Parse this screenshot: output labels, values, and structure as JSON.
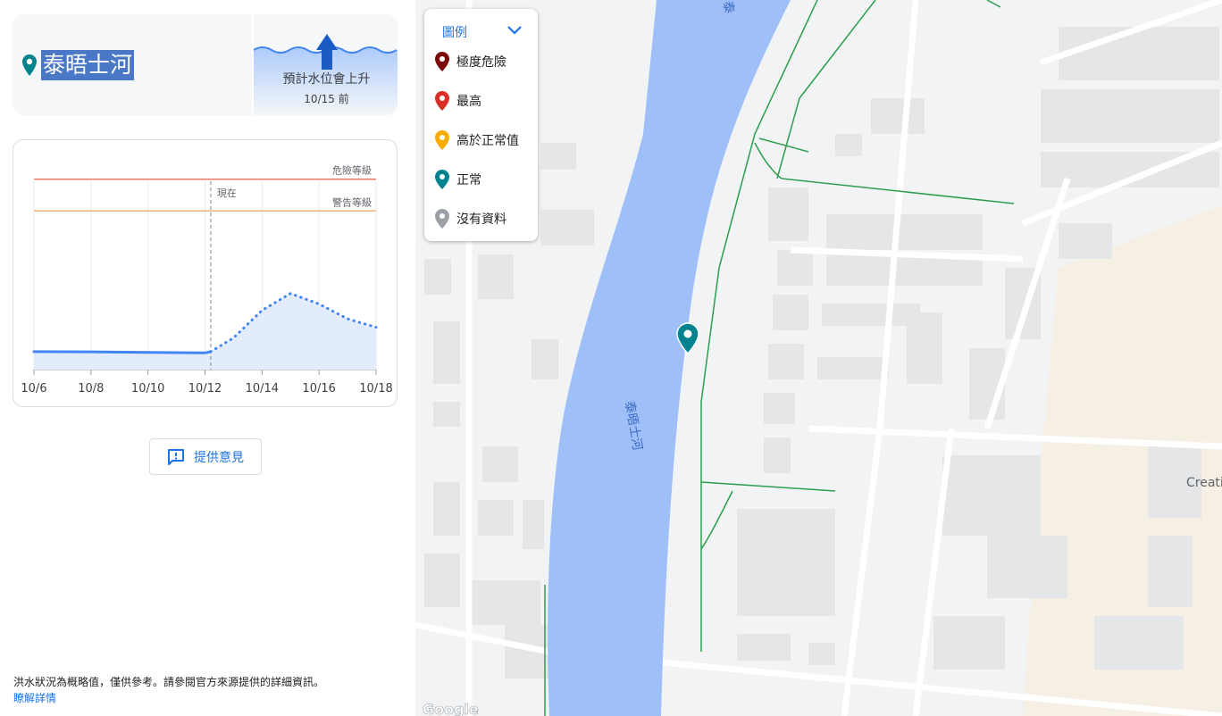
{
  "header": {
    "river_name": "泰晤士河",
    "forecast_label": "預計水位會上升",
    "forecast_date": "10/15 前"
  },
  "chart_data": {
    "type": "line",
    "x": [
      "10/6",
      "10/8",
      "10/10",
      "10/12",
      "10/14",
      "10/16",
      "10/18"
    ],
    "annotations": {
      "danger_label": "危險等級",
      "warning_label": "警告等級",
      "now_label": "現在"
    },
    "series": [
      {
        "kind": "observed",
        "points": [
          [
            0,
            0.85
          ],
          [
            1,
            0.84
          ],
          [
            2,
            0.81
          ],
          [
            3,
            0.79
          ],
          [
            3.1,
            0.85
          ]
        ]
      },
      {
        "kind": "forecast",
        "points": [
          [
            3.1,
            0.85
          ],
          [
            3.5,
            1.5
          ],
          [
            4,
            2.8
          ],
          [
            4.5,
            3.6
          ],
          [
            5,
            3.1
          ],
          [
            5.5,
            2.4
          ],
          [
            6,
            2.0
          ]
        ]
      }
    ],
    "danger_level": 9,
    "warning_level": 7.5,
    "now_x": 3.1,
    "ylim": [
      0,
      10
    ]
  },
  "feedback": {
    "label": "提供意見"
  },
  "footer": {
    "disclaimer": "洪水狀況為概略值，僅供參考。請參閱官方來源提供的詳細資訊。",
    "learn_more": "瞭解詳情"
  },
  "legend": {
    "title": "圖例",
    "items": [
      {
        "label": "極度危險",
        "color": "#7b0a0a"
      },
      {
        "label": "最高",
        "color": "#d93025"
      },
      {
        "label": "高於正常值",
        "color": "#f9ab00"
      },
      {
        "label": "正常",
        "color": "#00838f"
      },
      {
        "label": "沒有資料",
        "color": "#9aa0a6"
      }
    ]
  },
  "map": {
    "river_label_a": "泰晤士河",
    "river_label_b": "泰",
    "place_label": "Creati",
    "attribution": "Google"
  }
}
